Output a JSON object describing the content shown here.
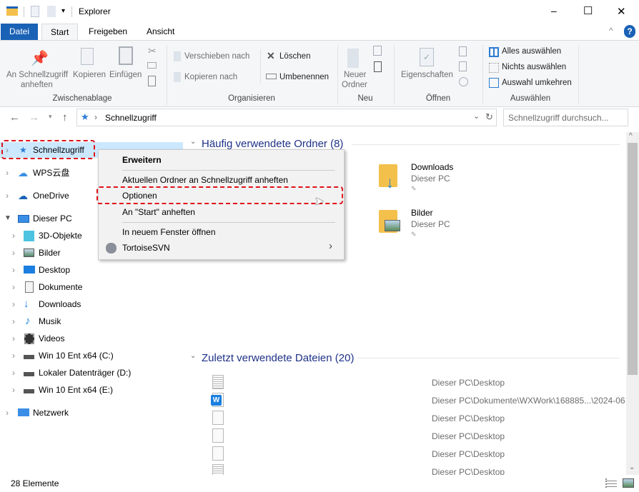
{
  "window": {
    "title": "Explorer",
    "minimize": "–",
    "maximize": "☐",
    "close": "✕"
  },
  "tabs": [
    {
      "label": "Datei"
    },
    {
      "label": "Start"
    },
    {
      "label": "Freigeben"
    },
    {
      "label": "Ansicht"
    }
  ],
  "help": "?",
  "ribbon": {
    "clipboard": {
      "pin": "An Schnellzugriff",
      "pin2": "anheften",
      "copy": "Kopieren",
      "paste": "Einfügen",
      "group": "Zwischenablage"
    },
    "organize": {
      "move": "Verschieben nach",
      "copyto": "Kopieren nach",
      "delete": "Löschen",
      "rename": "Umbenennen",
      "group": "Organisieren"
    },
    "new": {
      "folder": "Neuer",
      "folder2": "Ordner",
      "group": "Neu"
    },
    "open": {
      "properties": "Eigenschaften",
      "group": "Öffnen"
    },
    "select": {
      "all": "Alles auswählen",
      "none": "Nichts auswählen",
      "invert": "Auswahl umkehren",
      "group": "Auswählen"
    }
  },
  "address": {
    "path": "Schnellzugriff",
    "search_placeholder": "Schnellzugriff durchsuch..."
  },
  "nav": [
    {
      "label": "Schnellzugriff",
      "icon": "star-icon",
      "level": 0
    },
    {
      "label": "WPS云盘",
      "icon": "cloud-icon",
      "level": 0
    },
    {
      "label": "OneDrive",
      "icon": "cloud-icon",
      "level": 0
    },
    {
      "label": "Dieser PC",
      "icon": "pc-icon",
      "level": 0
    },
    {
      "label": "3D-Objekte",
      "icon": "cube-icon",
      "level": 1
    },
    {
      "label": "Bilder",
      "icon": "pictures-icon",
      "level": 1
    },
    {
      "label": "Desktop",
      "icon": "desktop-icon",
      "level": 1
    },
    {
      "label": "Dokumente",
      "icon": "documents-icon",
      "level": 1
    },
    {
      "label": "Downloads",
      "icon": "download-icon",
      "level": 1
    },
    {
      "label": "Musik",
      "icon": "music-icon",
      "level": 1
    },
    {
      "label": "Videos",
      "icon": "video-icon",
      "level": 1
    },
    {
      "label": "Win 10 Ent x64 (C:)",
      "icon": "drive-icon",
      "level": 1
    },
    {
      "label": "Lokaler Datenträger (D:)",
      "icon": "drive-icon",
      "level": 1
    },
    {
      "label": "Win 10 Ent x64 (E:)",
      "icon": "drive-icon",
      "level": 1
    },
    {
      "label": "Netzwerk",
      "icon": "network-icon",
      "level": 0
    }
  ],
  "content": {
    "frequent_header": "Häufig verwendete Ordner (8)",
    "folders": [
      {
        "name": "Downloads",
        "location": "Dieser PC"
      },
      {
        "name": "Bilder",
        "location": "Dieser PC"
      }
    ],
    "recent_header": "Zuletzt verwendete Dateien (20)",
    "files": [
      {
        "path": "Dieser PC\\Desktop"
      },
      {
        "path": "Dieser PC\\Dokumente\\WXWork\\168885...\\2024-06"
      },
      {
        "path": "Dieser PC\\Desktop"
      },
      {
        "path": "Dieser PC\\Desktop"
      },
      {
        "path": "Dieser PC\\Desktop"
      },
      {
        "path": "Dieser PC\\Desktop"
      }
    ]
  },
  "context_menu": {
    "expand": "Erweitern",
    "pin": "Aktuellen Ordner an Schnellzugriff anheften",
    "options": "Optionen",
    "pin_start": "An \"Start\" anheften",
    "new_window": "In neuem Fenster öffnen",
    "svn": "TortoiseSVN"
  },
  "status": {
    "count": "28 Elemente"
  },
  "colors": {
    "accent": "#1a62b5",
    "highlight": "#e0101a",
    "header": "#1e3287",
    "selection": "#cce8ff"
  }
}
